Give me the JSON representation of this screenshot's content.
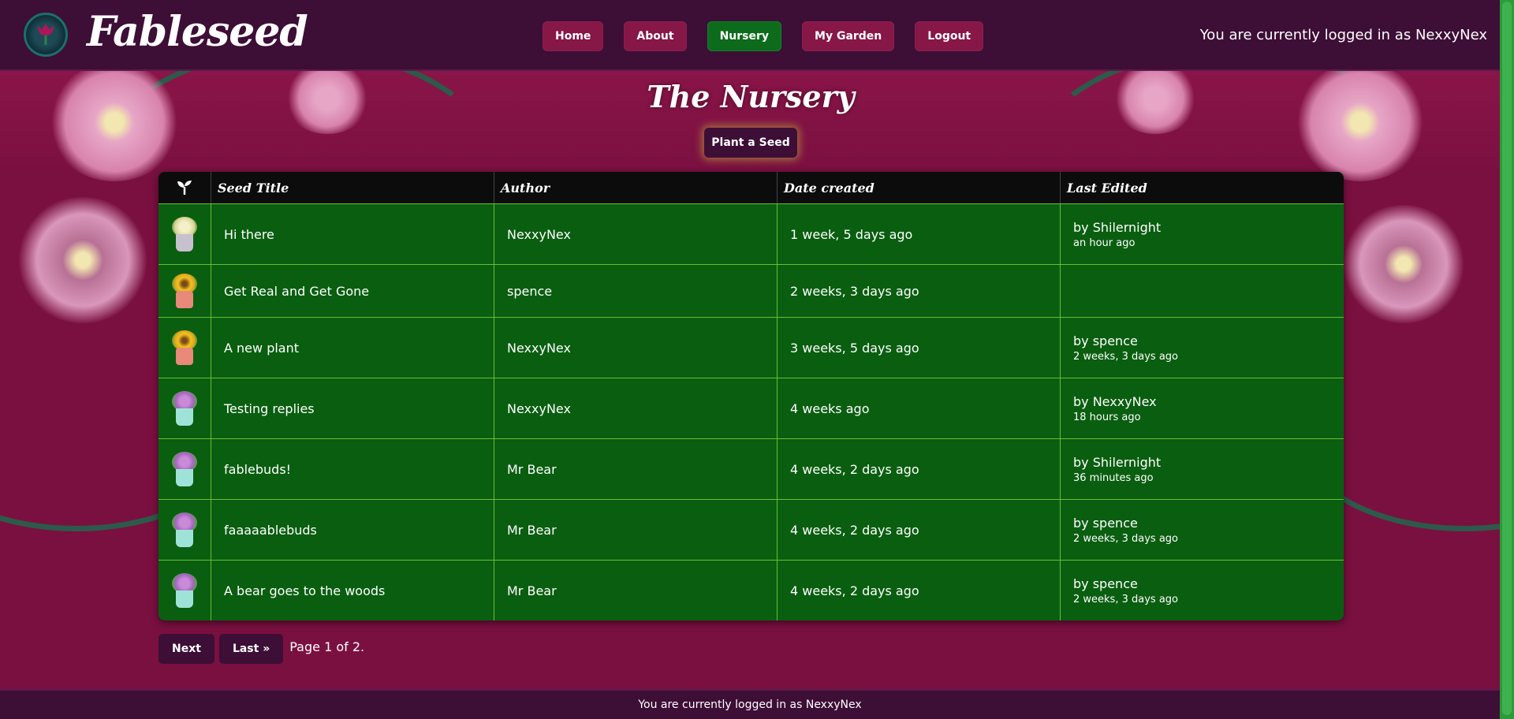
{
  "header": {
    "logo_text": "Fableseed",
    "nav": [
      {
        "label": "Home",
        "active": false
      },
      {
        "label": "About",
        "active": false
      },
      {
        "label": "Nursery",
        "active": true
      },
      {
        "label": "My Garden",
        "active": false
      },
      {
        "label": "Logout",
        "active": false
      }
    ],
    "login_status": "You are currently logged in as NexxyNex"
  },
  "page": {
    "title": "The Nursery",
    "plant_button": "Plant a Seed"
  },
  "table": {
    "headers": [
      "Seed Title",
      "Author",
      "Date created",
      "Last Edited"
    ],
    "rows": [
      {
        "icon": "white-flower-pot-icon",
        "title": "Hi there",
        "author": "NexxyNex",
        "created": "1 week, 5 days ago",
        "edited_by": "by Shilernight",
        "edited_when": "an hour ago"
      },
      {
        "icon": "sunflower-watering-can-icon",
        "title": "Get Real and Get Gone",
        "author": "spence",
        "created": "2 weeks, 3 days ago",
        "edited_by": "",
        "edited_when": ""
      },
      {
        "icon": "sunflower-watering-can-icon",
        "title": "A new plant",
        "author": "NexxyNex",
        "created": "3 weeks, 5 days ago",
        "edited_by": "by spence",
        "edited_when": "2 weeks, 3 days ago"
      },
      {
        "icon": "purple-flower-bucket-icon",
        "title": "Testing replies",
        "author": "NexxyNex",
        "created": "4 weeks ago",
        "edited_by": "by NexxyNex",
        "edited_when": "18 hours ago"
      },
      {
        "icon": "purple-flower-bucket-icon",
        "title": "fablebuds!",
        "author": "Mr Bear",
        "created": "4 weeks, 2 days ago",
        "edited_by": "by Shilernight",
        "edited_when": "36 minutes ago"
      },
      {
        "icon": "purple-flower-bucket-icon",
        "title": "faaaaablebuds",
        "author": "Mr Bear",
        "created": "4 weeks, 2 days ago",
        "edited_by": "by spence",
        "edited_when": "2 weeks, 3 days ago"
      },
      {
        "icon": "purple-flower-bucket-icon",
        "title": "A bear goes to the woods",
        "author": "Mr Bear",
        "created": "4 weeks, 2 days ago",
        "edited_by": "by spence",
        "edited_when": "2 weeks, 3 days ago"
      }
    ]
  },
  "pagination": {
    "next_label": "Next",
    "last_label": "Last »",
    "page_text": "Page 1 of 2."
  },
  "footer": {
    "login_status": "You are currently logged in as NexxyNex"
  },
  "colors": {
    "header_bg": "#3d0e36",
    "page_bg": "#7a1040",
    "table_bg": "#0a5e10",
    "active_nav": "#0d6b1c",
    "nav_button": "#861746"
  }
}
